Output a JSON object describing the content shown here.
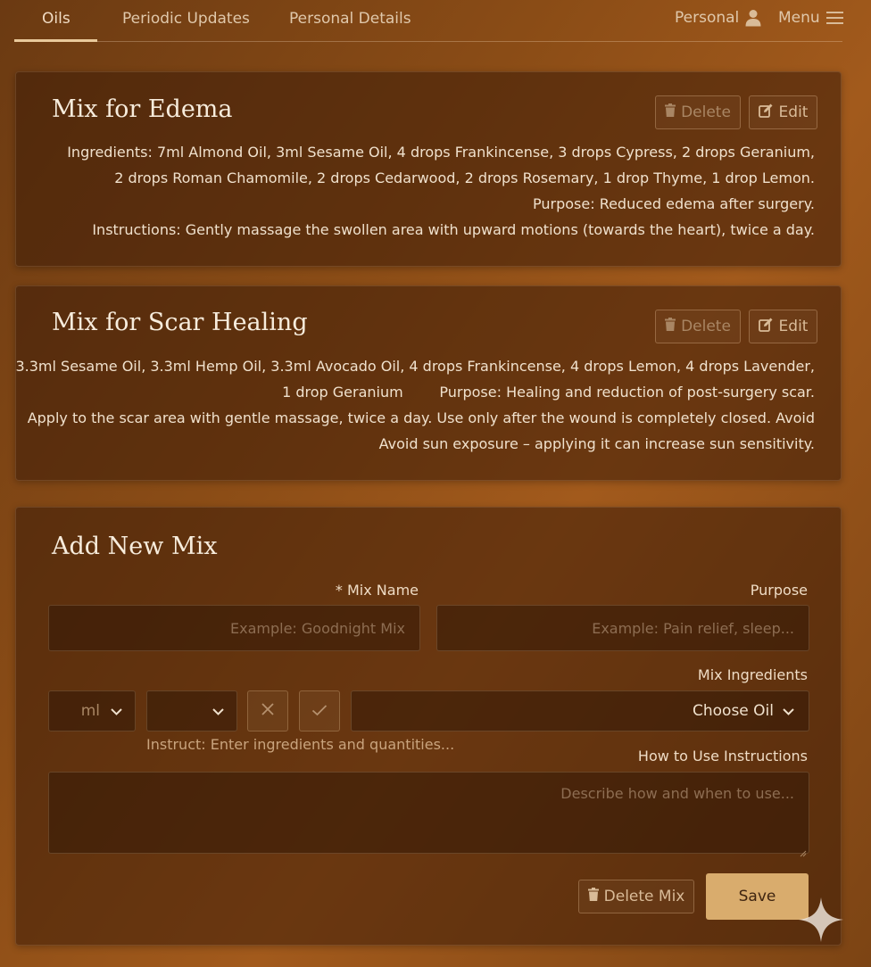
{
  "nav": {
    "tabs": [
      {
        "label": "Oils",
        "active": true
      },
      {
        "label": "Periodic Updates",
        "active": false
      },
      {
        "label": "Personal Details",
        "active": false
      }
    ],
    "personal_label": "Personal",
    "menu_label": "Menu"
  },
  "mixes": [
    {
      "title": "Mix for Edema",
      "delete_label": "Delete",
      "edit_label": "Edit",
      "lines": [
        "Ingredients: 7ml Almond Oil, 3ml Sesame Oil, 4 drops Frankincense, 3 drops Cypress, 2 drops Geranium,",
        "2 drops Roman Chamomile, 2 drops Cedarwood, 2 drops Rosemary, 1 drop Thyme, 1 drop Lemon.",
        "Purpose: Reduced edema after surgery.",
        "Instructions: Gently massage the swollen area with upward motions (towards the heart), twice a day."
      ]
    },
    {
      "title": "Mix for Scar Healing",
      "delete_label": "Delete",
      "edit_label": "Edit",
      "lines": [
        "3.3ml Sesame Oil, 3.3ml Hemp Oil, 3.3ml Avocado Oil, 4 drops Frankincense, 4 drops Lemon, 4 drops Lavender,",
        "1 drop Geranium        Purpose: Healing and reduction of post-surgery scar.",
        "Apply to the scar area with gentle massage, twice a day. Use only after the wound is completely closed. Avoid",
        "Avoid sun exposure – applying it can increase sun sensitivity."
      ]
    }
  ],
  "form": {
    "title": "Add New Mix",
    "mix_name_label": "* Mix Name",
    "mix_name_placeholder": "Example: Goodnight Mix",
    "purpose_label": "Purpose",
    "purpose_placeholder": "Example: Pain relief, sleep...",
    "ingredients_label": "Mix Ingredients",
    "unit_value": "ml",
    "amount_value": "",
    "oil_value": "Choose Oil",
    "ingredients_hint": "Instruct: Enter ingredients and quantities...",
    "instructions_label": "How to Use Instructions",
    "instructions_placeholder": "Describe how and when to use...",
    "delete_mix_label": "Delete Mix",
    "save_label": "Save"
  },
  "colors": {
    "accent": "#d9ac6d",
    "background": "#8a4c16",
    "card": "#3c1c08"
  }
}
